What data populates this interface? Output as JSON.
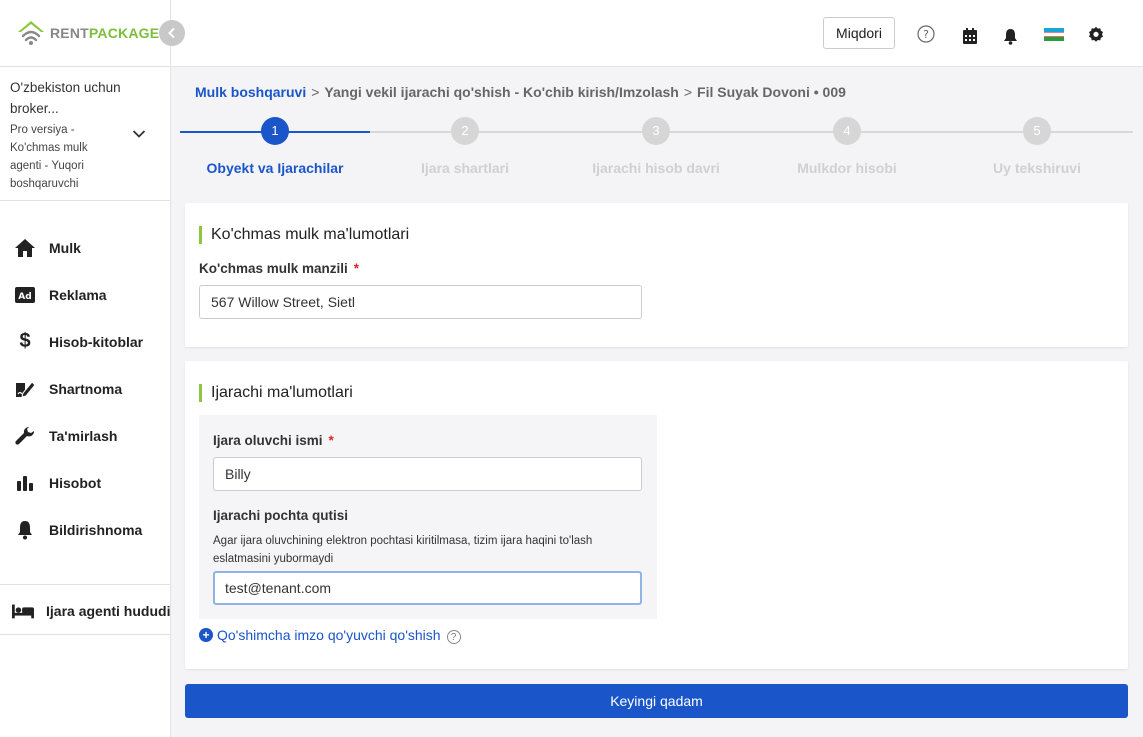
{
  "logo": {
    "rent": "RENT",
    "package": "PACKAGE"
  },
  "org": {
    "name": "O'zbekiston uchun broker...",
    "role": "Pro versiya - Ko'chmas mulk agenti - Yuqori boshqaruvchi"
  },
  "nav": [
    {
      "label": "Mulk",
      "icon": "home-icon"
    },
    {
      "label": "Reklama",
      "icon": "ad-icon"
    },
    {
      "label": "Hisob-kitoblar",
      "icon": "dollar-icon"
    },
    {
      "label": "Shartnoma",
      "icon": "contract-icon"
    },
    {
      "label": "Ta'mirlash",
      "icon": "wrench-icon"
    },
    {
      "label": "Hisobot",
      "icon": "bar-chart-icon"
    },
    {
      "label": "Bildirishnoma",
      "icon": "bell-icon"
    }
  ],
  "agent_zone": {
    "label": "Ijara agenti hududi",
    "icon": "bed-icon"
  },
  "header": {
    "miqdori": "Miqdori",
    "icons": [
      "help-icon",
      "calendar-icon",
      "bell-icon",
      "uzbekistan-flag-icon",
      "gear-icon"
    ]
  },
  "breadcrumb": {
    "root": "Mulk boshqaruvi",
    "sep": ">",
    "page": "Yangi vekil ijarachi qo'shish - Ko'chib kirish/Imzolash",
    "item": "Fil Suyak Dovoni • 009"
  },
  "steps": [
    {
      "num": "1",
      "label": "Obyekt va Ijarachilar",
      "active": true
    },
    {
      "num": "2",
      "label": "Ijara shartlari",
      "active": false
    },
    {
      "num": "3",
      "label": "Ijarachi hisob davri",
      "active": false
    },
    {
      "num": "4",
      "label": "Mulkdor hisobi",
      "active": false
    },
    {
      "num": "5",
      "label": "Uy tekshiruvi",
      "active": false
    }
  ],
  "property_card": {
    "title": "Ko'chmas mulk ma'lumotlari",
    "address_label": "Ko'chmas mulk manzili",
    "required_mark": "*",
    "address_value": "567 Willow Street, Sietl"
  },
  "tenant_card": {
    "title": "Ijarachi ma'lumotlari",
    "name_label": "Ijara oluvchi ismi",
    "required_mark": "*",
    "name_value": "Billy",
    "email_label": "Ijarachi pochta qutisi",
    "email_hint": "Agar ijara oluvchining elektron pochtasi kiritilmasa, tizim ijara haqini to'lash eslatmasini yubormaydi",
    "email_value": "test@tenant.com",
    "add_signer": "Qo'shimcha imzo qo'yuvchi qo'shish",
    "help_mark": "?"
  },
  "next_button": "Keyingi qadam",
  "colors": {
    "primary": "#1a55c9",
    "accent_green": "#8cc63f",
    "required": "#d9262b"
  }
}
